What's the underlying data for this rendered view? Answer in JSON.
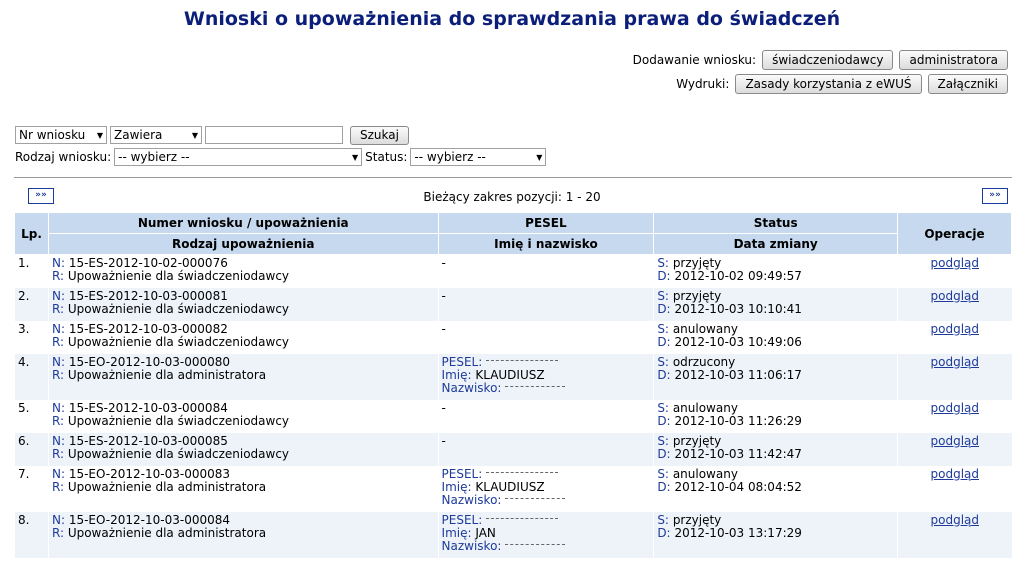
{
  "page": {
    "title": "Wnioski o upoważnienia do sprawdzania prawa do świadczeń"
  },
  "actions": {
    "add_label": "Dodawanie wniosku:",
    "add_buttons": [
      "świadczeniodawcy",
      "administratora"
    ],
    "print_label": "Wydruki:",
    "print_buttons": [
      "Zasady korzystania z eWUŚ",
      "Załączniki"
    ]
  },
  "filters": {
    "field_select": "Nr wniosku",
    "mode_select": "Zawiera",
    "search_value": "",
    "search_button": "Szukaj",
    "type_label": "Rodzaj wniosku:",
    "type_select": "-- wybierz --",
    "status_label": "Status:",
    "status_select": "-- wybierz --"
  },
  "pager": {
    "range_text": "Bieżący zakres pozycji: 1 - 20",
    "next_label": "»»"
  },
  "table": {
    "headers": {
      "lp": "Lp.",
      "number": "Numer wniosku / upoważnienia",
      "type": "Rodzaj upoważnienia",
      "pesel": "PESEL",
      "name": "Imię i nazwisko",
      "status": "Status",
      "date": "Data zmiany",
      "ops": "Operacje"
    },
    "prefix": {
      "n": "N:",
      "r": "R:",
      "s": "S:",
      "d": "D:",
      "pesel": "PESEL:",
      "imie": "Imię:",
      "nazwisko": "Nazwisko:"
    },
    "link_label": "podgląd",
    "rows": [
      {
        "lp": "1.",
        "n": "15-ES-2012-10-02-000076",
        "r": "Upoważnienie dla świadczeniodawcy",
        "person": "-",
        "s": "przyjęty",
        "d": "2012-10-02 09:49:57"
      },
      {
        "lp": "2.",
        "n": "15-ES-2012-10-03-000081",
        "r": "Upoważnienie dla świadczeniodawcy",
        "person": "-",
        "s": "przyjęty",
        "d": "2012-10-03 10:10:41"
      },
      {
        "lp": "3.",
        "n": "15-ES-2012-10-03-000082",
        "r": "Upoważnienie dla świadczeniodawcy",
        "person": "-",
        "s": "anulowany",
        "d": "2012-10-03 10:49:06"
      },
      {
        "lp": "4.",
        "n": "15-EO-2012-10-03-000080",
        "r": "Upoważnienie dla administratora",
        "imie": "KLAUDIUSZ",
        "s": "odrzucony",
        "d": "2012-10-03 11:06:17"
      },
      {
        "lp": "5.",
        "n": "15-ES-2012-10-03-000084",
        "r": "Upoważnienie dla świadczeniodawcy",
        "person": "-",
        "s": "anulowany",
        "d": "2012-10-03 11:26:29"
      },
      {
        "lp": "6.",
        "n": "15-ES-2012-10-03-000085",
        "r": "Upoważnienie dla świadczeniodawcy",
        "person": "-",
        "s": "przyjęty",
        "d": "2012-10-03 11:42:47"
      },
      {
        "lp": "7.",
        "n": "15-EO-2012-10-03-000083",
        "r": "Upoważnienie dla administratora",
        "imie": "KLAUDIUSZ",
        "s": "anulowany",
        "d": "2012-10-04 08:04:52"
      },
      {
        "lp": "8.",
        "n": "15-EO-2012-10-03-000084",
        "r": "Upoważnienie dla administratora",
        "imie": "JAN",
        "s": "przyjęty",
        "d": "2012-10-03 13:17:29"
      }
    ]
  }
}
